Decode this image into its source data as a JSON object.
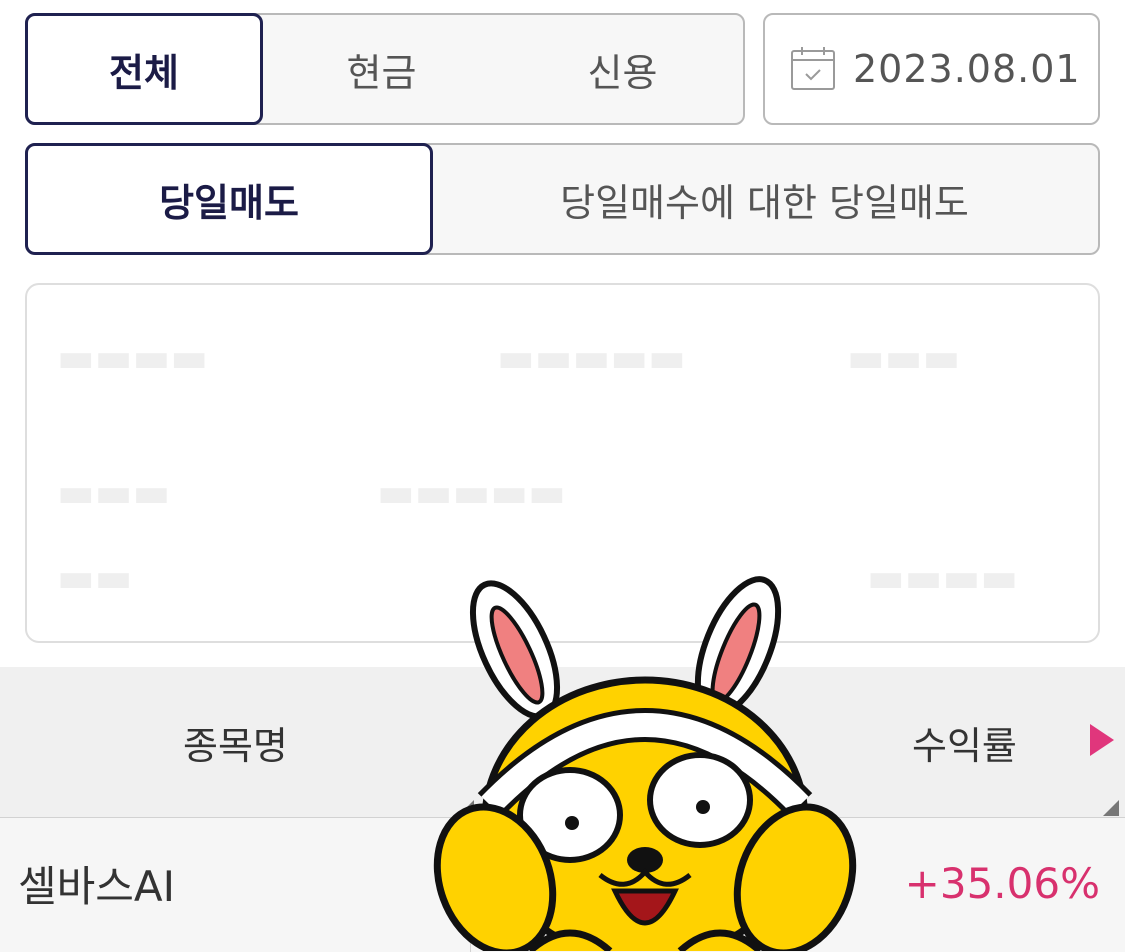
{
  "account_filter": {
    "options": [
      "전체",
      "현금",
      "신용"
    ],
    "selected": "전체"
  },
  "date_picker": {
    "value": "2023.08.01",
    "icon": "calendar-icon"
  },
  "trade_filter": {
    "options": [
      "당일매도",
      "당일매수에 대한 당일매도"
    ],
    "selected": "당일매도"
  },
  "list": {
    "columns": {
      "name": "종목명",
      "return_rate": "수익률"
    },
    "scroll_indicator_icon": "triangle-right-icon",
    "rows": [
      {
        "name": "셀바스AI",
        "return_rate": "+35.06%"
      }
    ]
  },
  "colors": {
    "active_border": "#1f2150",
    "positive": "#d8316e",
    "scroll_indicator": "#e0367c"
  }
}
